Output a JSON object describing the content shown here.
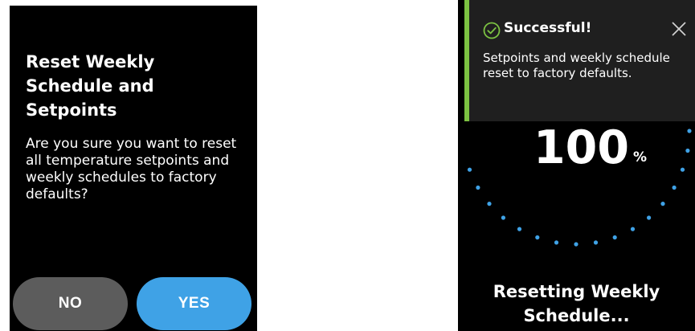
{
  "reset_dialog": {
    "title": "Reset Weekly Schedule and Setpoints",
    "message": "Are you sure you want to reset all temperature setpoints and weekly schedules to factory defaults?",
    "no_label": "NO",
    "yes_label": "YES"
  },
  "progress_screen": {
    "toast": {
      "icon": "check-circle-icon",
      "title": "Successful!",
      "message": "Setpoints and weekly schedule reset to factory defaults.",
      "close_icon": "close-icon"
    },
    "progress_value": "100",
    "progress_unit": "%",
    "status_text": "Resetting Weekly Schedule..."
  },
  "colors": {
    "yes_button": "#3fa2e6",
    "no_button": "#5c5c5c",
    "success_accent": "#7cc242",
    "progress_dots": "#3fa2e6"
  }
}
